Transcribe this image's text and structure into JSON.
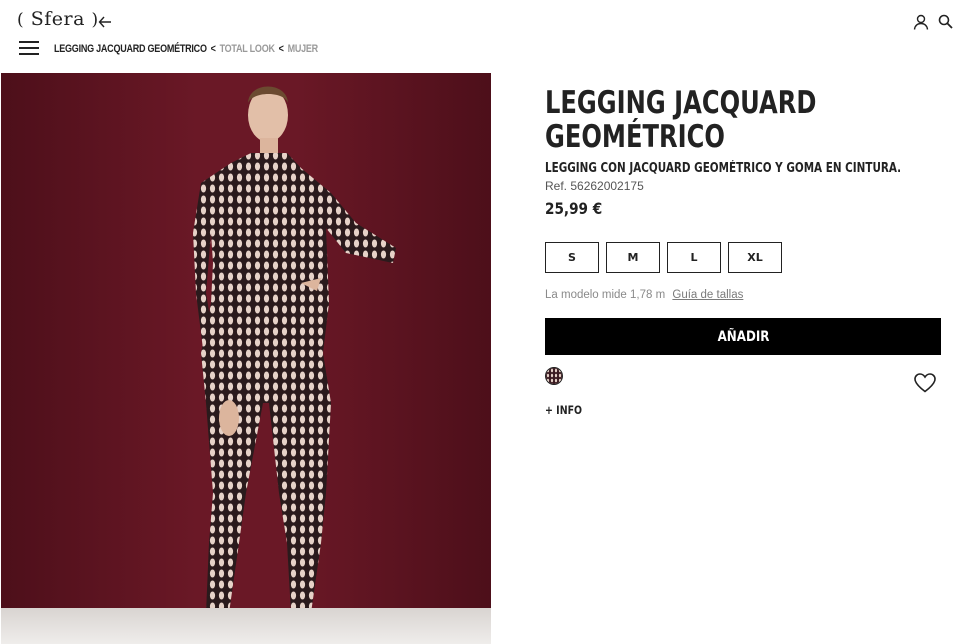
{
  "header": {
    "logo_text": "Sfera",
    "logo_open": "(",
    "logo_close": ")"
  },
  "breadcrumb": {
    "current": "LEGGING JACQUARD GEOMÉTRICO",
    "sep1": "<",
    "item1": "TOTAL LOOK",
    "sep2": "<",
    "item2": "MUJER"
  },
  "product": {
    "title": "LEGGING JACQUARD GEOMÉTRICO",
    "description": "LEGGING CON JACQUARD GEOMÉTRICO Y GOMA EN CINTURA.",
    "ref": "Ref. 56262002175",
    "price": "25,99 €",
    "sizes": [
      "S",
      "M",
      "L",
      "XL"
    ],
    "model_info": "La modelo mide 1,78 m",
    "size_guide": "Guía de tallas",
    "add_label": "AÑADIR",
    "more_info": "+ INFO",
    "background_color": "#5e1420"
  }
}
